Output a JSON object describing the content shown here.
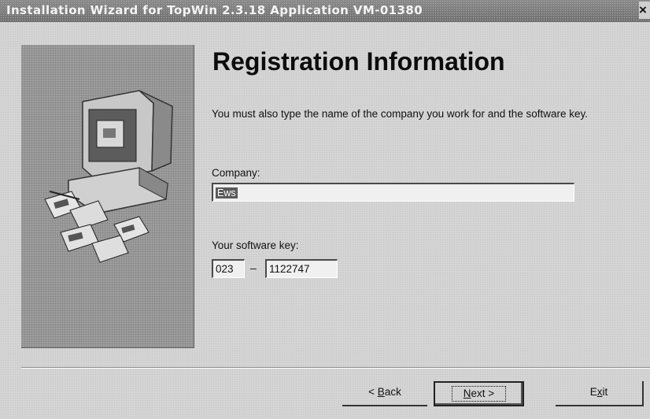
{
  "window": {
    "title": "Installation Wizard for TopWin 2.3.18 Application VM-01380",
    "close_glyph": "×"
  },
  "page": {
    "heading": "Registration Information",
    "description": "You must also type the name of the company you work for and the software key."
  },
  "company": {
    "label": "Company:",
    "value": "Ews"
  },
  "software_key": {
    "label": "Your software key:",
    "part1": "023",
    "separator": "–",
    "part2": "1122747"
  },
  "buttons": {
    "back": {
      "pre": "< ",
      "accel": "B",
      "rest": "ack"
    },
    "next": {
      "accel": "N",
      "rest": "ext >"
    },
    "exit": {
      "pre": "E",
      "accel": "x",
      "rest": "it"
    }
  }
}
